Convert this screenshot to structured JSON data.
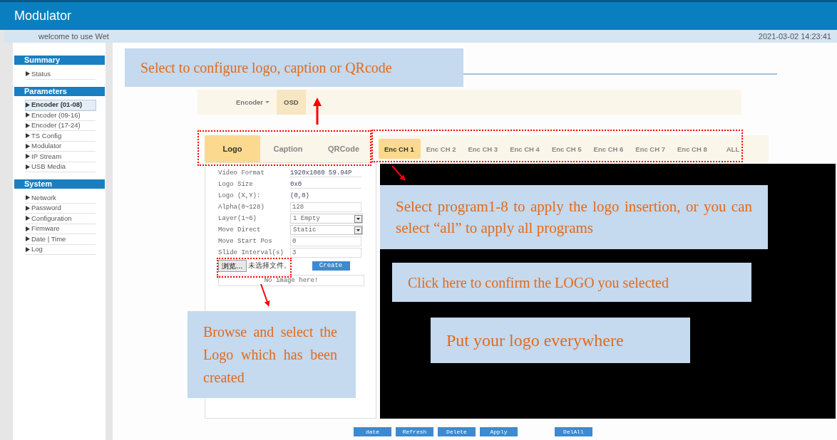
{
  "header": {
    "title": "Modulator"
  },
  "welcome": "welcome to use Wet",
  "datetime": "2021-03-02 14:23:41",
  "sidebar": [
    {
      "title": "Summary",
      "items": [
        {
          "label": "Status",
          "selected": false
        }
      ]
    },
    {
      "title": "Parameters",
      "items": [
        {
          "label": "Encoder (01-08)",
          "selected": true
        },
        {
          "label": "Encoder (09-16)",
          "selected": false
        },
        {
          "label": "Encoder (17-24)",
          "selected": false
        },
        {
          "label": "TS Config",
          "selected": false
        },
        {
          "label": "Modulator",
          "selected": false
        },
        {
          "label": "IP Stream",
          "selected": false
        },
        {
          "label": "USB Media",
          "selected": false
        }
      ]
    },
    {
      "title": "System",
      "items": [
        {
          "label": "Network",
          "selected": false
        },
        {
          "label": "Password",
          "selected": false
        },
        {
          "label": "Configuration",
          "selected": false
        },
        {
          "label": "Firmware",
          "selected": false
        },
        {
          "label": "Date | Time",
          "selected": false
        },
        {
          "label": "Log",
          "selected": false
        }
      ]
    }
  ],
  "menu_tabs": [
    {
      "label": "Encoder",
      "dropdown": true,
      "selected": false
    },
    {
      "label": "OSD",
      "dropdown": false,
      "selected": true
    }
  ],
  "osd_tabs": [
    {
      "label": "Logo",
      "selected": true
    },
    {
      "label": "Caption",
      "selected": false
    },
    {
      "label": "QRCode",
      "selected": false
    }
  ],
  "channel_tabs": [
    {
      "label": "Enc CH 1",
      "selected": true
    },
    {
      "label": "Enc CH 2",
      "selected": false
    },
    {
      "label": "Enc CH 3",
      "selected": false
    },
    {
      "label": "Enc CH 4",
      "selected": false
    },
    {
      "label": "Enc CH 5",
      "selected": false
    },
    {
      "label": "Enc CH 6",
      "selected": false
    },
    {
      "label": "Enc CH 7",
      "selected": false
    },
    {
      "label": "Enc CH 8",
      "selected": false
    },
    {
      "label": "ALL",
      "selected": false
    }
  ],
  "form": [
    {
      "label": "Video Format",
      "value": "1920x1080 59.94P",
      "kind": "info"
    },
    {
      "label": "Logo Size",
      "value": "0x0",
      "kind": "info"
    },
    {
      "label": "Logo (X,Y):",
      "value": "(0,0)",
      "kind": "plain"
    },
    {
      "label": "Alpha(0~128)",
      "value": "128",
      "kind": "input"
    },
    {
      "label": "Layer(1~6)",
      "value": "1 Empty",
      "kind": "select"
    },
    {
      "label": "Move Direct",
      "value": "Static",
      "kind": "select"
    },
    {
      "label": "Move Start Pos",
      "value": "0",
      "kind": "input"
    },
    {
      "label": "Slide Interval(s)",
      "value": "3",
      "kind": "input"
    }
  ],
  "file_picker": {
    "button": "浏览...",
    "status": "未选择文件。"
  },
  "create_button": "Create",
  "image_status": "No image here!",
  "buttons": [
    "date",
    "Refresh",
    "Delete",
    "Apply",
    "DelAll"
  ],
  "annotations": [
    {
      "text": "Select to configure logo, caption or QRcode"
    },
    {
      "text": "Select program1-8 to apply the logo insertion, or you can select “all” to apply all programs"
    },
    {
      "text": "Click here to confirm the LOGO you selected"
    },
    {
      "text": "Browse and select the Logo which has been created"
    },
    {
      "text": "Put your logo everywhere"
    }
  ]
}
